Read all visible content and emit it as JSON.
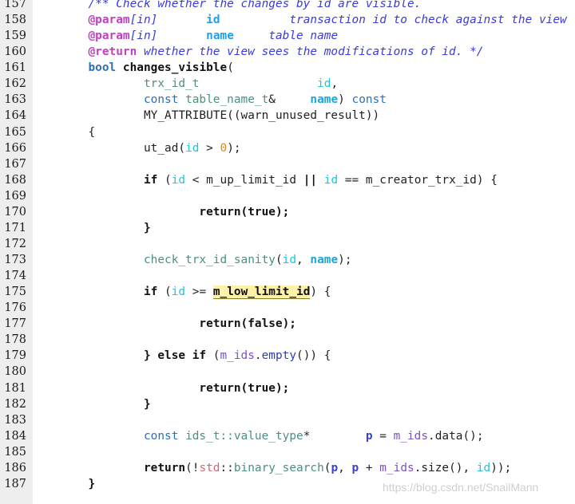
{
  "editor": {
    "language": "cpp",
    "background_color": "#ffffff",
    "gutter_color": "#eeeeee",
    "first_line_number": 157,
    "last_line_number": 187,
    "highlight_color": "#fff2a8",
    "highlighted_token": "m_low_limit_id"
  },
  "watermark": {
    "text": "https://blog.csdn.net/SnailMann",
    "color": "#cfcfcf"
  },
  "lines": [
    {
      "n": "157",
      "tokens": [
        {
          "t": "        ",
          "c": "t-plain"
        },
        {
          "t": "/** Check whether the changes by id are visible.",
          "c": "t-comment"
        }
      ]
    },
    {
      "n": "158",
      "tokens": [
        {
          "t": "        ",
          "c": "t-plain"
        },
        {
          "t": "@param",
          "c": "t-doctag"
        },
        {
          "t": "[in]",
          "c": "t-comment"
        },
        {
          "t": "       ",
          "c": "t-plain"
        },
        {
          "t": "id",
          "c": "t-docparam"
        },
        {
          "t": "          ",
          "c": "t-plain"
        },
        {
          "t": "transaction id to check against the view",
          "c": "t-comment"
        }
      ]
    },
    {
      "n": "159",
      "tokens": [
        {
          "t": "        ",
          "c": "t-plain"
        },
        {
          "t": "@param",
          "c": "t-doctag"
        },
        {
          "t": "[in]",
          "c": "t-comment"
        },
        {
          "t": "       ",
          "c": "t-plain"
        },
        {
          "t": "name",
          "c": "t-docparam"
        },
        {
          "t": "     ",
          "c": "t-plain"
        },
        {
          "t": "table name",
          "c": "t-comment"
        }
      ]
    },
    {
      "n": "160",
      "tokens": [
        {
          "t": "        ",
          "c": "t-plain"
        },
        {
          "t": "@return",
          "c": "t-doctag"
        },
        {
          "t": " whether the view sees the modifications of id. */",
          "c": "t-comment"
        }
      ]
    },
    {
      "n": "161",
      "tokens": [
        {
          "t": "        ",
          "c": "t-plain"
        },
        {
          "t": "bool",
          "c": "t-keyword"
        },
        {
          "t": " ",
          "c": "t-plain"
        },
        {
          "t": "changes_visible",
          "c": "t-bold"
        },
        {
          "t": "(",
          "c": "t-plain"
        }
      ]
    },
    {
      "n": "162",
      "tokens": [
        {
          "t": "                ",
          "c": "t-plain"
        },
        {
          "t": "trx_id_t",
          "c": "t-type"
        },
        {
          "t": "                 ",
          "c": "t-plain"
        },
        {
          "t": "id",
          "c": "t-ident"
        },
        {
          "t": ",",
          "c": "t-plain"
        }
      ]
    },
    {
      "n": "163",
      "tokens": [
        {
          "t": "                ",
          "c": "t-plain"
        },
        {
          "t": "const",
          "c": "t-type2"
        },
        {
          "t": " ",
          "c": "t-plain"
        },
        {
          "t": "table_name_t",
          "c": "t-type"
        },
        {
          "t": "&",
          "c": "t-plain"
        },
        {
          "t": "     ",
          "c": "t-plain"
        },
        {
          "t": "name",
          "c": "t-identb"
        },
        {
          "t": ") ",
          "c": "t-plain"
        },
        {
          "t": "const",
          "c": "t-type2"
        }
      ]
    },
    {
      "n": "164",
      "tokens": [
        {
          "t": "                ",
          "c": "t-plain"
        },
        {
          "t": "MY_ATTRIBUTE((warn_unused_result))",
          "c": "t-plain"
        }
      ]
    },
    {
      "n": "165",
      "tokens": [
        {
          "t": "        ",
          "c": "t-plain"
        },
        {
          "t": "{",
          "c": "t-plain"
        }
      ]
    },
    {
      "n": "166",
      "tokens": [
        {
          "t": "                ",
          "c": "t-plain"
        },
        {
          "t": "ut_ad(",
          "c": "t-plain"
        },
        {
          "t": "id",
          "c": "t-ident"
        },
        {
          "t": " > ",
          "c": "t-plain"
        },
        {
          "t": "0",
          "c": "t-num"
        },
        {
          "t": ");",
          "c": "t-plain"
        }
      ]
    },
    {
      "n": "167",
      "tokens": []
    },
    {
      "n": "168",
      "tokens": [
        {
          "t": "                ",
          "c": "t-plain"
        },
        {
          "t": "if",
          "c": "t-op"
        },
        {
          "t": " (",
          "c": "t-plain"
        },
        {
          "t": "id",
          "c": "t-ident"
        },
        {
          "t": " < ",
          "c": "t-plain"
        },
        {
          "t": "m_up_limit_id",
          "c": "t-member"
        },
        {
          "t": " ",
          "c": "t-plain"
        },
        {
          "t": "||",
          "c": "t-op"
        },
        {
          "t": " ",
          "c": "t-plain"
        },
        {
          "t": "id",
          "c": "t-ident"
        },
        {
          "t": " == ",
          "c": "t-plain"
        },
        {
          "t": "m_creator_trx_id",
          "c": "t-member"
        },
        {
          "t": ") {",
          "c": "t-plain"
        }
      ]
    },
    {
      "n": "169",
      "tokens": []
    },
    {
      "n": "170",
      "tokens": [
        {
          "t": "                        ",
          "c": "t-plain"
        },
        {
          "t": "return(true);",
          "c": "t-op"
        }
      ]
    },
    {
      "n": "171",
      "tokens": [
        {
          "t": "                ",
          "c": "t-plain"
        },
        {
          "t": "}",
          "c": "t-op"
        }
      ]
    },
    {
      "n": "172",
      "tokens": []
    },
    {
      "n": "173",
      "tokens": [
        {
          "t": "                ",
          "c": "t-plain"
        },
        {
          "t": "check_trx_id_sanity",
          "c": "t-func"
        },
        {
          "t": "(",
          "c": "t-plain"
        },
        {
          "t": "id",
          "c": "t-ident"
        },
        {
          "t": ", ",
          "c": "t-plain"
        },
        {
          "t": "name",
          "c": "t-identb"
        },
        {
          "t": ");",
          "c": "t-plain"
        }
      ]
    },
    {
      "n": "174",
      "tokens": []
    },
    {
      "n": "175",
      "tokens": [
        {
          "t": "                ",
          "c": "t-plain"
        },
        {
          "t": "if",
          "c": "t-op"
        },
        {
          "t": " (",
          "c": "t-plain"
        },
        {
          "t": "id",
          "c": "t-ident"
        },
        {
          "t": " >= ",
          "c": "t-plain"
        },
        {
          "t": "m_low_limit_id",
          "c": "t-hl"
        },
        {
          "t": ") {",
          "c": "t-plain"
        }
      ]
    },
    {
      "n": "176",
      "tokens": []
    },
    {
      "n": "177",
      "tokens": [
        {
          "t": "                        ",
          "c": "t-plain"
        },
        {
          "t": "return(false);",
          "c": "t-op"
        }
      ]
    },
    {
      "n": "178",
      "tokens": []
    },
    {
      "n": "179",
      "tokens": [
        {
          "t": "                ",
          "c": "t-plain"
        },
        {
          "t": "} ",
          "c": "t-op"
        },
        {
          "t": "else if",
          "c": "t-op"
        },
        {
          "t": " (",
          "c": "t-plain"
        },
        {
          "t": "m_ids",
          "c": "t-var"
        },
        {
          "t": ".",
          "c": "t-plain"
        },
        {
          "t": "empty",
          "c": "t-func2"
        },
        {
          "t": "()) {",
          "c": "t-plain"
        }
      ]
    },
    {
      "n": "180",
      "tokens": []
    },
    {
      "n": "181",
      "tokens": [
        {
          "t": "                        ",
          "c": "t-plain"
        },
        {
          "t": "return(true);",
          "c": "t-op"
        }
      ]
    },
    {
      "n": "182",
      "tokens": [
        {
          "t": "                ",
          "c": "t-plain"
        },
        {
          "t": "}",
          "c": "t-op"
        }
      ]
    },
    {
      "n": "183",
      "tokens": []
    },
    {
      "n": "184",
      "tokens": [
        {
          "t": "                ",
          "c": "t-plain"
        },
        {
          "t": "const",
          "c": "t-type2"
        },
        {
          "t": " ",
          "c": "t-plain"
        },
        {
          "t": "ids_t::value_type",
          "c": "t-type"
        },
        {
          "t": "*",
          "c": "t-plain"
        },
        {
          "t": "        ",
          "c": "t-plain"
        },
        {
          "t": "p",
          "c": "t-varb"
        },
        {
          "t": " = ",
          "c": "t-plain"
        },
        {
          "t": "m_ids",
          "c": "t-var"
        },
        {
          "t": ".",
          "c": "t-plain"
        },
        {
          "t": "data",
          "c": "t-plain"
        },
        {
          "t": "();",
          "c": "t-plain"
        }
      ]
    },
    {
      "n": "185",
      "tokens": []
    },
    {
      "n": "186",
      "tokens": [
        {
          "t": "                ",
          "c": "t-plain"
        },
        {
          "t": "return",
          "c": "t-op"
        },
        {
          "t": "(!",
          "c": "t-plain"
        },
        {
          "t": "std",
          "c": "t-ns"
        },
        {
          "t": "::",
          "c": "t-plain"
        },
        {
          "t": "binary_search",
          "c": "t-func"
        },
        {
          "t": "(",
          "c": "t-plain"
        },
        {
          "t": "p",
          "c": "t-varb"
        },
        {
          "t": ", ",
          "c": "t-plain"
        },
        {
          "t": "p",
          "c": "t-varb"
        },
        {
          "t": " + ",
          "c": "t-plain"
        },
        {
          "t": "m_ids",
          "c": "t-var"
        },
        {
          "t": ".",
          "c": "t-plain"
        },
        {
          "t": "size",
          "c": "t-plain"
        },
        {
          "t": "(), ",
          "c": "t-plain"
        },
        {
          "t": "id",
          "c": "t-ident"
        },
        {
          "t": "));",
          "c": "t-plain"
        }
      ]
    },
    {
      "n": "187",
      "tokens": [
        {
          "t": "        ",
          "c": "t-plain"
        },
        {
          "t": "}",
          "c": "t-op"
        }
      ]
    }
  ]
}
